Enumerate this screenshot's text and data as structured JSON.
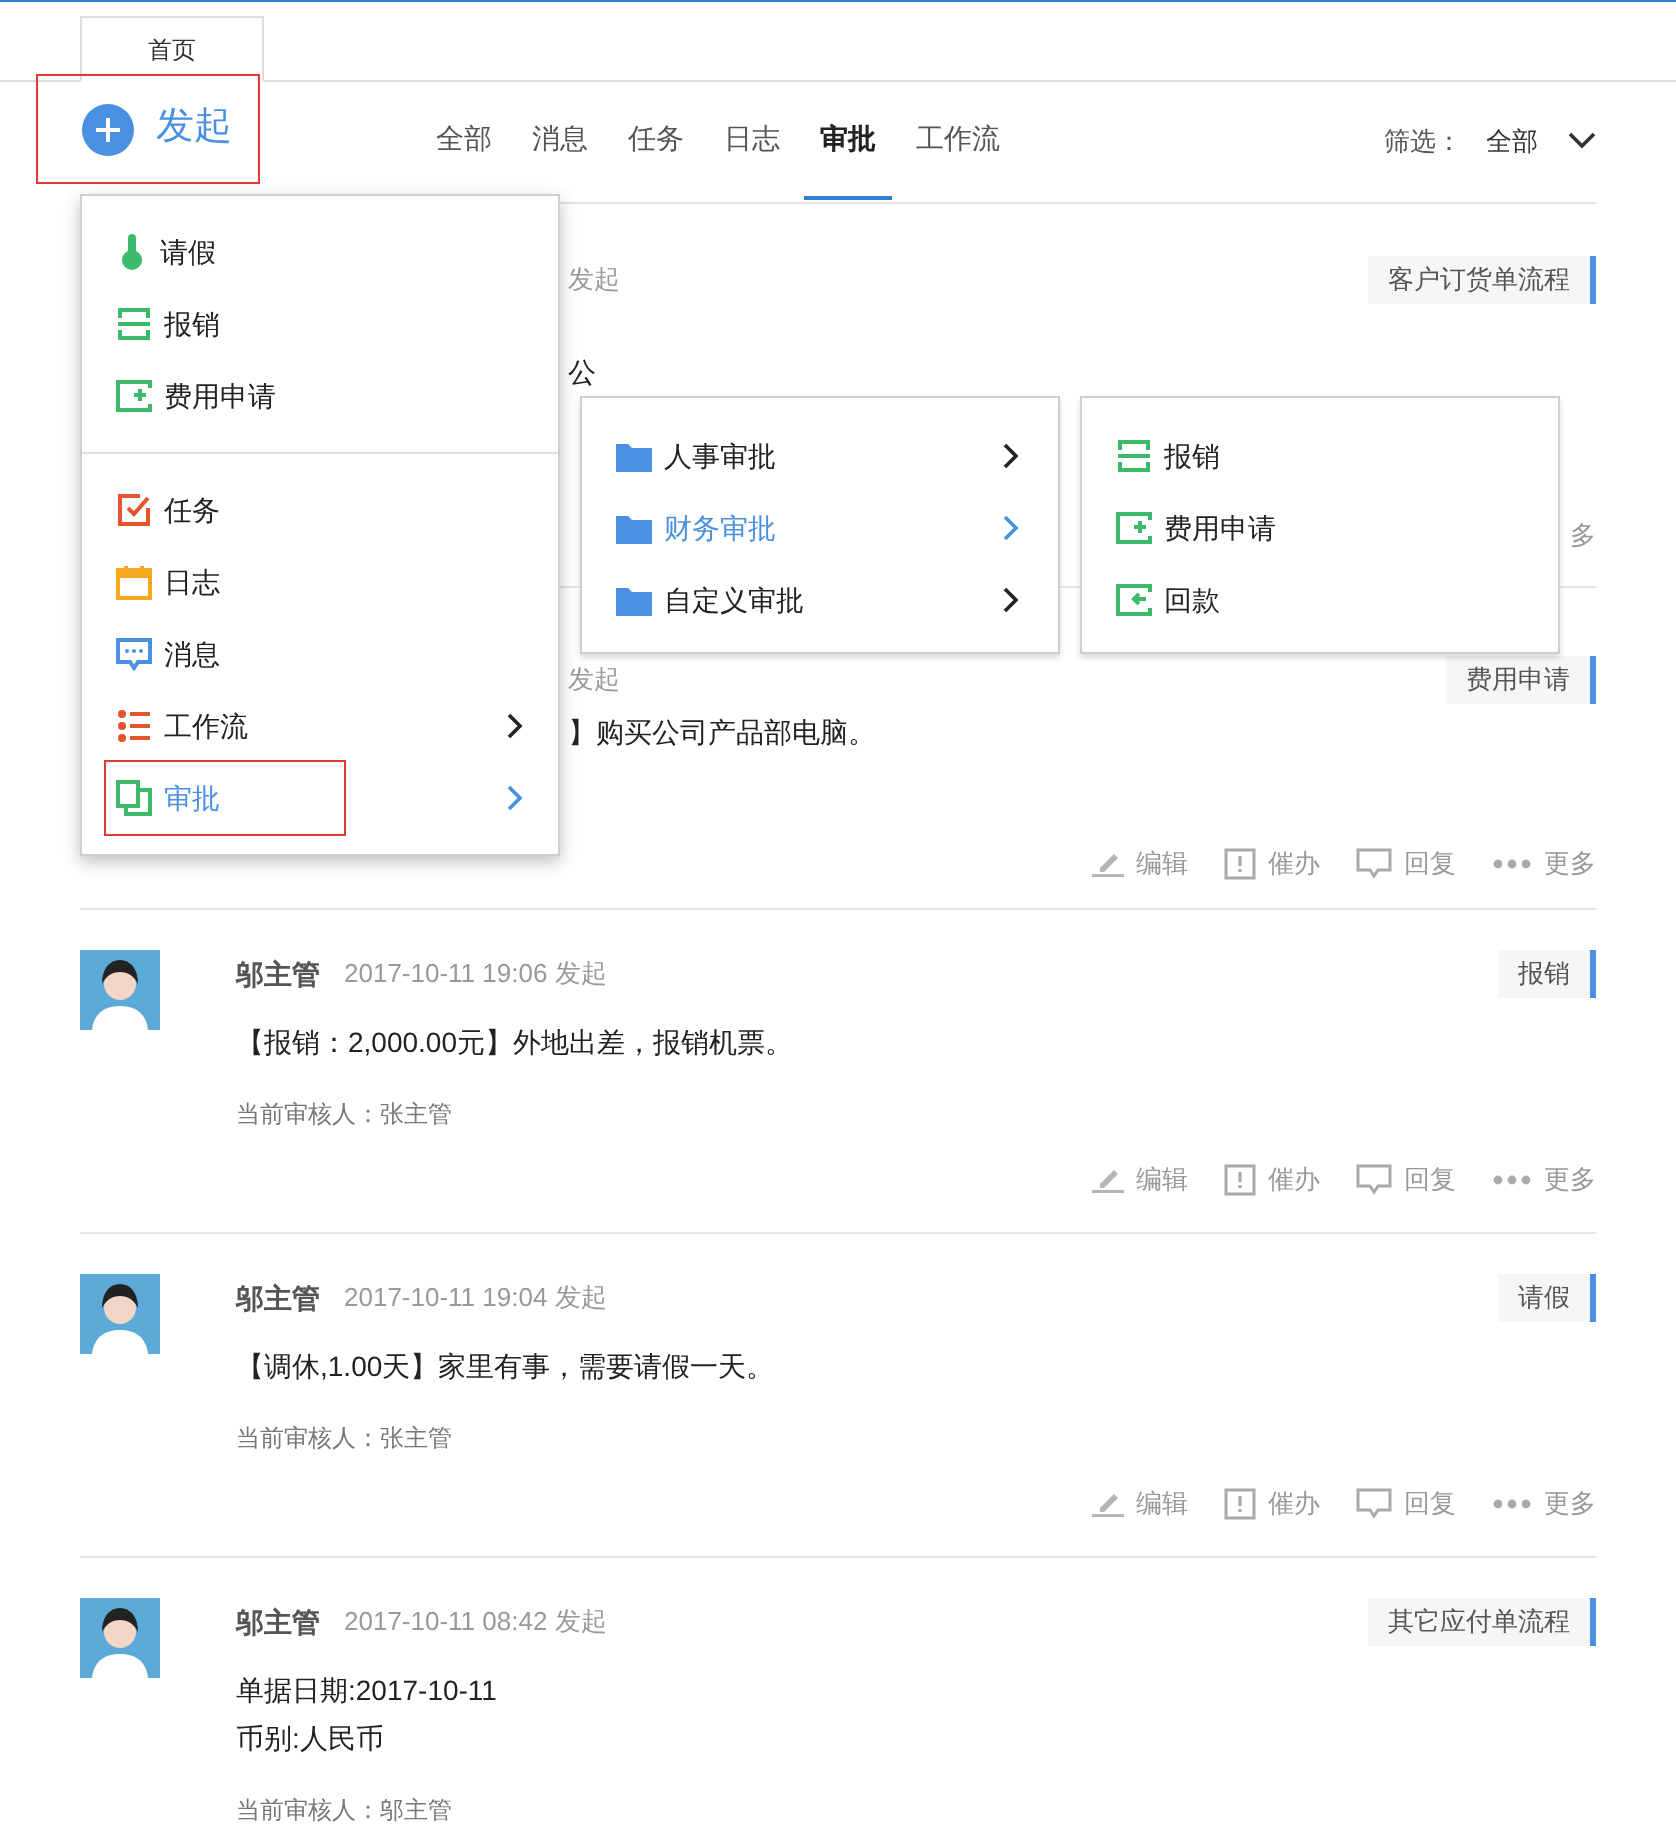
{
  "top_tab": {
    "label": "首页",
    "selected": true
  },
  "launch_button": {
    "label": "发起",
    "highlighted": true
  },
  "nav_tabs": [
    {
      "label": "全部",
      "selected": false
    },
    {
      "label": "消息",
      "selected": false
    },
    {
      "label": "任务",
      "selected": false
    },
    {
      "label": "日志",
      "selected": false
    },
    {
      "label": "审批",
      "selected": true
    },
    {
      "label": "工作流",
      "selected": false
    }
  ],
  "filter": {
    "label": "筛选：",
    "value": "全部"
  },
  "feed": [
    {
      "kind": "partial",
      "time": "发起",
      "tag": "客户订货单流程",
      "lines": [
        {
          "left": "公"
        },
        {
          "right": "多"
        }
      ]
    },
    {
      "kind": "partial",
      "time": "发起",
      "tag": "费用申请",
      "lines": [
        {
          "left": "】购买公司产品部电脑。"
        }
      ],
      "actions": [
        {
          "kind": "edit",
          "label": "编辑"
        },
        {
          "kind": "urge",
          "label": "催办"
        },
        {
          "kind": "reply",
          "label": "回复"
        },
        {
          "kind": "more",
          "label": "更多"
        }
      ]
    },
    {
      "kind": "full",
      "name": "邬主管",
      "time": "2017-10-11 19:06 发起",
      "tag": "报销",
      "content": [
        "【报销：2,000.00元】外地出差，报销机票。"
      ],
      "reviewer": "当前审核人：张主管",
      "actions": [
        {
          "kind": "edit",
          "label": "编辑"
        },
        {
          "kind": "urge",
          "label": "催办"
        },
        {
          "kind": "reply",
          "label": "回复"
        },
        {
          "kind": "more",
          "label": "更多"
        }
      ]
    },
    {
      "kind": "full",
      "name": "邬主管",
      "time": "2017-10-11 19:04 发起",
      "tag": "请假",
      "content": [
        "【调休,1.00天】家里有事，需要请假一天。"
      ],
      "reviewer": "当前审核人：张主管",
      "actions": [
        {
          "kind": "edit",
          "label": "编辑"
        },
        {
          "kind": "urge",
          "label": "催办"
        },
        {
          "kind": "reply",
          "label": "回复"
        },
        {
          "kind": "more",
          "label": "更多"
        }
      ]
    },
    {
      "kind": "full",
      "name": "邬主管",
      "time": "2017-10-11 08:42 发起",
      "tag": "其它应付单流程",
      "content": [
        "单据日期:2017-10-11",
        "币别:人民币"
      ],
      "reviewer": "当前审核人：邬主管"
    }
  ],
  "launch_menu": {
    "groups": [
      [
        {
          "kind": "thermometer",
          "label": "请假",
          "selected": false,
          "submenu": false,
          "highlighted": false
        },
        {
          "kind": "receipt",
          "label": "报销",
          "selected": false,
          "submenu": false,
          "highlighted": false
        },
        {
          "kind": "expense",
          "label": "费用申请",
          "selected": false,
          "submenu": false,
          "highlighted": false
        }
      ],
      [
        {
          "kind": "task",
          "label": "任务",
          "selected": false,
          "submenu": false,
          "highlighted": false
        },
        {
          "kind": "calendar",
          "label": "日志",
          "selected": false,
          "submenu": false,
          "highlighted": false
        },
        {
          "kind": "message",
          "label": "消息",
          "selected": false,
          "submenu": false,
          "highlighted": false
        },
        {
          "kind": "list",
          "label": "工作流",
          "selected": false,
          "submenu": true,
          "highlighted": false
        },
        {
          "kind": "approve",
          "label": "审批",
          "selected": true,
          "submenu": true,
          "highlighted": true
        }
      ]
    ]
  },
  "approval_menu": [
    {
      "label": "人事审批",
      "selected": false
    },
    {
      "label": "财务审批",
      "selected": true
    },
    {
      "label": "自定义审批",
      "selected": false
    }
  ],
  "finance_menu": [
    {
      "kind": "receipt",
      "label": "报销"
    },
    {
      "kind": "expense",
      "label": "费用申请"
    },
    {
      "kind": "refund",
      "label": "回款"
    }
  ]
}
